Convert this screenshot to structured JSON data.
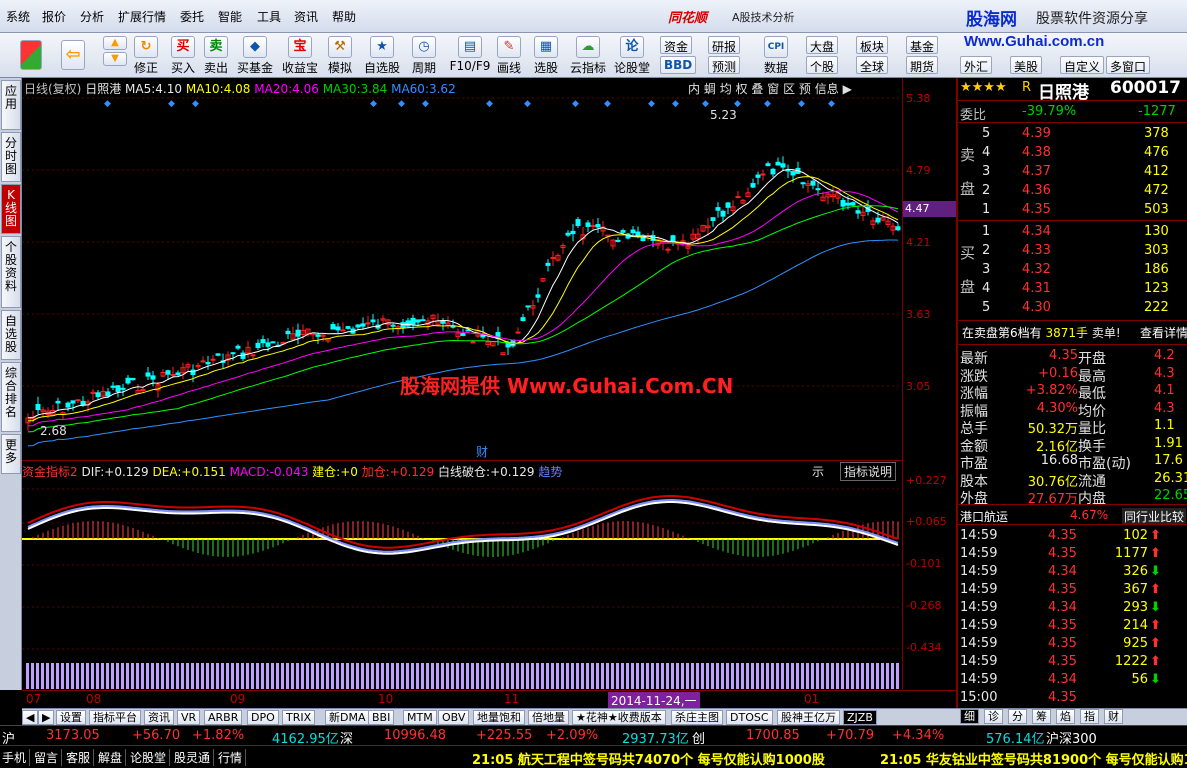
{
  "menubar": {
    "items": [
      "系统",
      "报价",
      "分析",
      "扩展行情",
      "委托",
      "智能",
      "工具",
      "资讯",
      "帮助"
    ],
    "app_name": "同花顺",
    "app_sub": "A股技术分析",
    "brand": "股海网",
    "brand_slogan": "股票软件资源分享",
    "brand_url": "Www.Guhai.com.cn"
  },
  "toolbar": {
    "buttons": [
      "买入",
      "卖出",
      "买基金",
      "收益宝",
      "模拟",
      "自选股",
      "周期",
      "F10/F9",
      "画线",
      "选股",
      "云指标",
      "论股堂",
      "数据"
    ],
    "icons": [
      "买",
      "卖",
      "◆",
      "宝",
      "⚒"
    ],
    "buttons_top": [
      "修正"
    ],
    "small": [
      "资金",
      "研报",
      "CPI",
      "大盘",
      "板块",
      "基金",
      "BBD",
      "预测",
      "个股",
      "全球",
      "期货",
      "外汇",
      "美股",
      "自定义",
      "多窗口"
    ]
  },
  "lefttabs": [
    "应用",
    "分时图",
    "K线图",
    "个股资料",
    "自选股",
    "综合排名",
    "更多"
  ],
  "kchart": {
    "period": "日线(复权)",
    "name": "日照港",
    "ma5_label": "MA5:",
    "ma5": "4.10",
    "ma10_label": "MA10:",
    "ma10": "4.08",
    "ma20_label": "MA20:",
    "ma20": "4.06",
    "ma30_label": "MA30:",
    "ma30": "3.84",
    "ma60_label": "MA60:",
    "ma60": "3.62",
    "toolbar": [
      "内",
      "蜩",
      "均",
      "权",
      "叠",
      "窗",
      "区",
      "预",
      "信息"
    ],
    "high_label": "5.23",
    "low_label": "2.68",
    "fin_label": "财",
    "colors": {
      "up": "#ff2020",
      "down": "#00ffff",
      "ma5": "#ffffff",
      "ma10": "#ffff00",
      "ma20": "#ff00ff",
      "ma30": "#00ff00",
      "ma60": "#3090ff"
    }
  },
  "ind": {
    "name": "资金指标2",
    "dif_label": "DIF:",
    "dif": "+0.129",
    "dea_label": "DEA:",
    "dea": "+0.151",
    "macd_label": "MACD:",
    "macd": "-0.043",
    "jc_label": "建仓:",
    "jc": "+0",
    "jia_label": "加仓:",
    "jia": "+0.129",
    "bai_label": "白线破仓:",
    "bai": "+0.129",
    "trend": "趋势",
    "tab1": "示",
    "tab2": "指标说明"
  },
  "yaxis": {
    "k": [
      "5.38",
      "4.79",
      "4.21",
      "3.63",
      "3.05"
    ],
    "current": "4.47",
    "ind": [
      "+0.227",
      "+0.065",
      "-0.101",
      "-0.268",
      "-0.434"
    ]
  },
  "xaxis": {
    "labels": [
      "07",
      "08",
      "09",
      "10",
      "11",
      "01"
    ],
    "cursor": "2014-11-24,一"
  },
  "quote": {
    "stars": "★★★★",
    "r": "R",
    "name": "日照港",
    "code": "600017",
    "weibi_label": "委比",
    "weibi": "-39.79%",
    "weicha": "-1277",
    "sell_label": [
      "卖",
      "盘"
    ],
    "buy_label": [
      "买",
      "盘"
    ],
    "asks": [
      {
        "n": "5",
        "p": "4.39",
        "v": "378"
      },
      {
        "n": "4",
        "p": "4.38",
        "v": "476"
      },
      {
        "n": "3",
        "p": "4.37",
        "v": "412"
      },
      {
        "n": "2",
        "p": "4.36",
        "v": "472"
      },
      {
        "n": "1",
        "p": "4.35",
        "v": "503"
      }
    ],
    "bids": [
      {
        "n": "1",
        "p": "4.34",
        "v": "130"
      },
      {
        "n": "2",
        "p": "4.33",
        "v": "303"
      },
      {
        "n": "3",
        "p": "4.32",
        "v": "186"
      },
      {
        "n": "4",
        "p": "4.31",
        "v": "123"
      },
      {
        "n": "5",
        "p": "4.30",
        "v": "222"
      }
    ],
    "notice1": "在卖盘第6档有",
    "notice2": "3871手",
    "notice3": "卖单!",
    "notice4": "查看详情",
    "stats": [
      {
        "l": "最新",
        "v": "4.35",
        "l2": "开盘",
        "v2": "4.2"
      },
      {
        "l": "涨跌",
        "v": "+0.16",
        "l2": "最高",
        "v2": "4.3"
      },
      {
        "l": "涨幅",
        "v": "+3.82%",
        "l2": "最低",
        "v2": "4.1"
      },
      {
        "l": "振幅",
        "v": "4.30%",
        "l2": "均价",
        "v2": "4.3"
      },
      {
        "l": "总手",
        "v": "50.32万",
        "l2": "量比",
        "v2": "1.1"
      },
      {
        "l": "金额",
        "v": "2.16亿",
        "l2": "换手",
        "v2": "1.91"
      },
      {
        "l": "市盈",
        "v": "16.68",
        "l2": "市盈(动)",
        "v2": "17.6"
      },
      {
        "l": "股本",
        "v": "30.76亿",
        "l2": "流通",
        "v2": "26.31"
      },
      {
        "l": "外盘",
        "v": "27.67万",
        "l2": "内盘",
        "v2": "22.65"
      }
    ],
    "sector": "港口航运",
    "sector_pct": "4.67%",
    "sector_cmp": "同行业比较",
    "ticks": [
      {
        "t": "14:59",
        "p": "4.35",
        "v": "102",
        "d": "up"
      },
      {
        "t": "14:59",
        "p": "4.35",
        "v": "1177",
        "d": "up"
      },
      {
        "t": "14:59",
        "p": "4.34",
        "v": "326",
        "d": "down"
      },
      {
        "t": "14:59",
        "p": "4.35",
        "v": "367",
        "d": "up"
      },
      {
        "t": "14:59",
        "p": "4.34",
        "v": "293",
        "d": "down"
      },
      {
        "t": "14:59",
        "p": "4.35",
        "v": "214",
        "d": "up"
      },
      {
        "t": "14:59",
        "p": "4.35",
        "v": "925",
        "d": "up"
      },
      {
        "t": "14:59",
        "p": "4.35",
        "v": "1222",
        "d": "up"
      },
      {
        "t": "14:59",
        "p": "4.34",
        "v": "56",
        "d": "down"
      },
      {
        "t": "15:00",
        "p": "4.35",
        "v": "",
        "d": ""
      }
    ],
    "tabs": [
      "细",
      "诊",
      "分",
      "筹",
      "焰",
      "指",
      "财"
    ]
  },
  "btabs": [
    "设置",
    "指标平台",
    "资讯",
    "VR",
    "ARBR",
    "DPO",
    "TRIX",
    "新DMA",
    "BBI",
    "MTM",
    "OBV",
    "地量饱和",
    "倍地量",
    "★花神★收费版本",
    "杀庄主图",
    "DTOSC",
    "股神王亿万",
    "ZJZB"
  ],
  "status1": {
    "sh": "沪",
    "sh_val": "3173.05",
    "sh_chg": "+56.70",
    "sh_pct": "+1.82%",
    "sh_amt": "4162.95亿",
    "sz": "深",
    "sz_val": "10996.48",
    "sz_chg": "+225.55",
    "sz_pct": "+2.09%",
    "sz_amt": "2937.73亿",
    "cy": "创",
    "cy_val": "1700.85",
    "cy_chg": "+70.79",
    "cy_pct": "+4.34%",
    "hs_amt": "576.14亿",
    "hs": "沪深300"
  },
  "status2": {
    "items": [
      "手机",
      "留言",
      "客服",
      "解盘",
      "论股堂",
      "股灵通",
      "行情"
    ],
    "news1": "21:05 航天工程中签号码共74070个 每号仅能认购1000股",
    "news2": "21:05 华友钴业中签号码共81900个 每号仅能认购1"
  },
  "watermark": "股海网提供 Www.Guhai.Com.CN"
}
